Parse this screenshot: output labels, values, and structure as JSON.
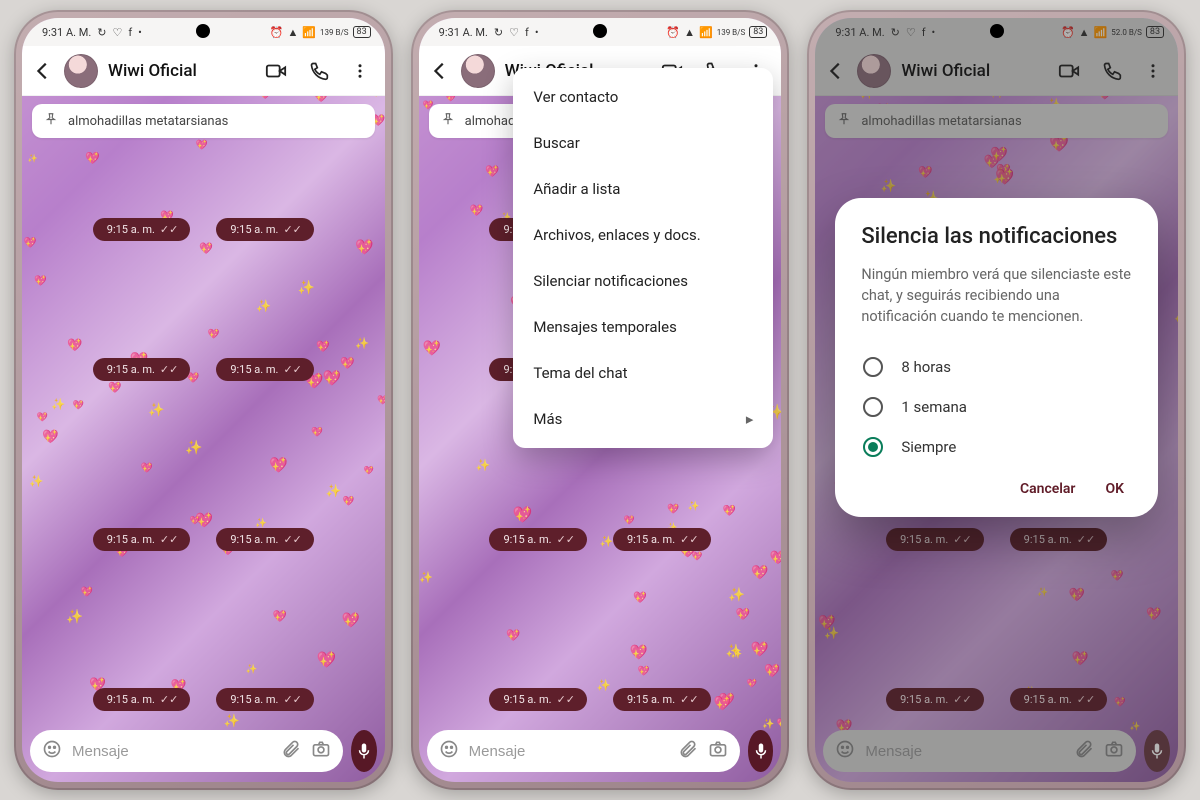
{
  "status": {
    "time": "9:31 A. M.",
    "net_label": "139 B/S",
    "net_label_alt": "52.0 B/S",
    "battery": "83"
  },
  "chat": {
    "title": "Wiwi Oficial",
    "pinned": "almohadillas metatarsianas",
    "compose_placeholder": "Mensaje",
    "timestamp": "9:15 a. m."
  },
  "menu": {
    "items": [
      "Ver contacto",
      "Buscar",
      "Añadir a lista",
      "Archivos, enlaces y docs.",
      "Silenciar notificaciones",
      "Mensajes temporales",
      "Tema del chat",
      "Más"
    ]
  },
  "dialog": {
    "title": "Silencia las notificaciones",
    "body": "Ningún miembro verá que silenciaste este chat, y seguirás recibiendo una notificación cuando te mencionen.",
    "options": [
      "8 horas",
      "1 semana",
      "Siempre"
    ],
    "selected": "Siempre",
    "cancel": "Cancelar",
    "ok": "OK"
  },
  "pill_rows": [
    70,
    210,
    380,
    540
  ]
}
